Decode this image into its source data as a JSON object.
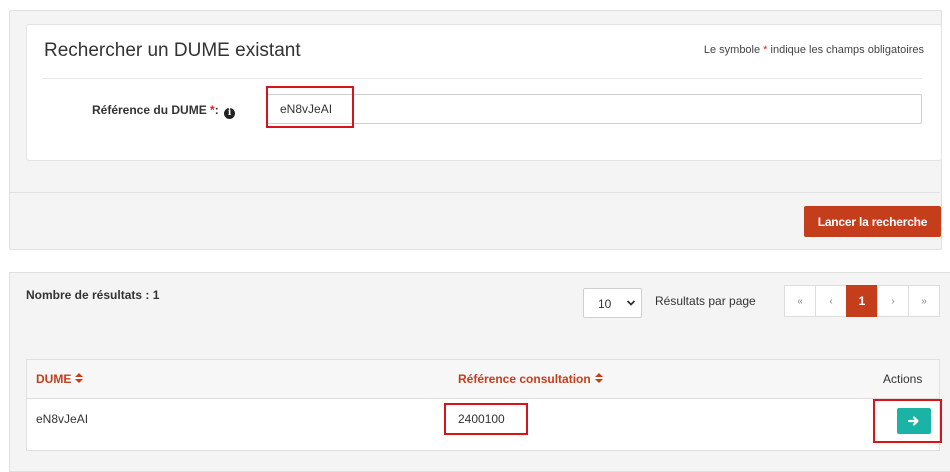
{
  "search": {
    "title": "Rechercher un DUME existant",
    "required_note_prefix": "Le symbole ",
    "required_star": "*",
    "required_note_suffix": " indique les champs obligatoires",
    "field_label": "Référence du DUME ",
    "field_star": "*",
    "field_colon": ":",
    "field_value": "eN8vJeAI",
    "info_icon": "info-icon",
    "button_label": "Lancer la recherche"
  },
  "results": {
    "count_label": "Nombre de résultats : 1",
    "per_page_value": "10",
    "per_page_label": "Résultats par page",
    "pager": {
      "first": "«",
      "prev": "‹",
      "current": "1",
      "next": "›",
      "last": "»"
    },
    "table": {
      "headers": [
        "DUME",
        "Référence consultation",
        "Actions"
      ],
      "rows": [
        {
          "dume": "eN8vJeAI",
          "reference": "2400100",
          "action_icon": "arrow-right-icon"
        }
      ]
    }
  },
  "colors": {
    "accent": "#c53e1c",
    "action": "#1bb3a6",
    "highlight": "#d7141a"
  }
}
